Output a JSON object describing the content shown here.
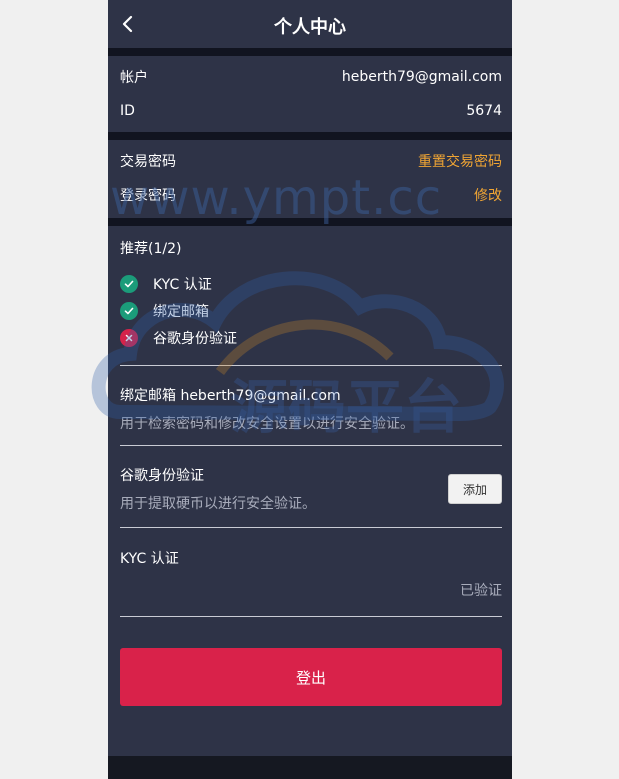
{
  "header": {
    "title": "个人中心"
  },
  "account": {
    "account_label": "帐户",
    "account_value": "heberth79@gmail.com",
    "id_label": "ID",
    "id_value": "5674"
  },
  "security": {
    "trade_pwd_label": "交易密码",
    "trade_pwd_action": "重置交易密码",
    "login_pwd_label": "登录密码",
    "login_pwd_action": "修改"
  },
  "recommend": {
    "title": "推荐(1/2)",
    "items": [
      {
        "label": "KYC 认证",
        "status": "ok"
      },
      {
        "label": "绑定邮箱",
        "status": "ok"
      },
      {
        "label": "谷歌身份验证",
        "status": "bad"
      }
    ]
  },
  "bind_email": {
    "title": "绑定邮箱 heberth79@gmail.com",
    "desc": "用于检索密码和修改安全设置以进行安全验证。"
  },
  "google_auth": {
    "title": "谷歌身份验证",
    "desc": "用于提取硬币以进行安全验证。",
    "add_label": "添加"
  },
  "kyc": {
    "title": "KYC 认证",
    "status": "已验证"
  },
  "logout": {
    "label": "登出"
  },
  "watermark": {
    "text": "www.ympt.cc",
    "brand": "源码平台"
  },
  "colors": {
    "accent": "#f0a534",
    "danger": "#d9224a",
    "ok": "#1b9c7a",
    "card_bg": "#2e3347",
    "page_bg": "#151821"
  }
}
